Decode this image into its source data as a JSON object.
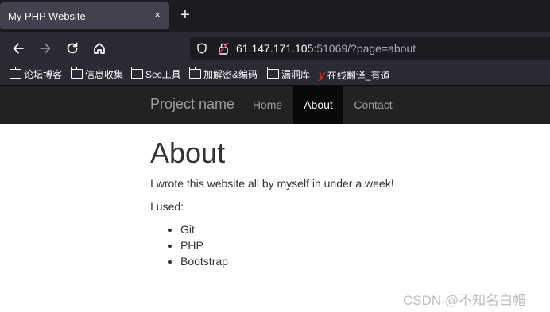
{
  "browser": {
    "tab_title": "My PHP Website",
    "tab_close": "×",
    "new_tab": "+",
    "url_host": "61.147.171.105",
    "url_rest": ":51069/?page=about",
    "icons": {
      "back": "back-arrow-icon",
      "forward": "forward-arrow-icon",
      "reload": "reload-icon",
      "home": "home-icon",
      "shield": "shield-icon",
      "lock": "insecure-lock-icon"
    },
    "bookmarks": [
      {
        "label": "论坛博客"
      },
      {
        "label": "信息收集"
      },
      {
        "label": "Sec工具"
      },
      {
        "label": "加解密&编码"
      },
      {
        "label": "漏洞库"
      },
      {
        "label": "在线翻译_有道"
      }
    ]
  },
  "site": {
    "brand": "Project name",
    "nav": [
      {
        "label": "Home",
        "active": false
      },
      {
        "label": "About",
        "active": true
      },
      {
        "label": "Contact",
        "active": false
      }
    ],
    "page_title": "About",
    "intro": "I wrote this website all by myself in under a week!",
    "used_label": "I used:",
    "tools": [
      "Git",
      "PHP",
      "Bootstrap"
    ]
  },
  "watermark": "CSDN @不知名白帽",
  "colors": {
    "tab_bg": "#42414d",
    "toolbar_bg": "#2b2a33",
    "site_nav_bg": "#222222",
    "site_nav_active": "#080808",
    "text": "#333333"
  }
}
